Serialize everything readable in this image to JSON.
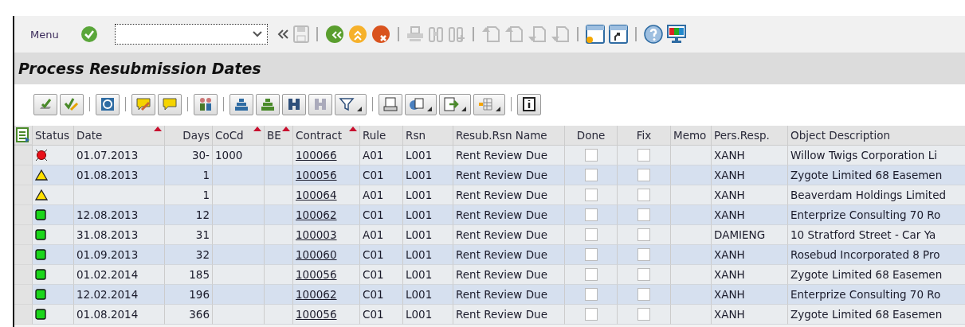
{
  "toolbar": {
    "menu": "Menu"
  },
  "title": "Process Resubmission Dates",
  "table": {
    "columns": [
      {
        "label": "Status",
        "sorted": false
      },
      {
        "label": "Date",
        "sorted": true
      },
      {
        "label": "Days",
        "sorted": false
      },
      {
        "label": "CoCd",
        "sorted": true
      },
      {
        "label": "BE",
        "sorted": true
      },
      {
        "label": "Contract",
        "sorted": true
      },
      {
        "label": "Rule",
        "sorted": false
      },
      {
        "label": "Rsn",
        "sorted": false
      },
      {
        "label": "Resub.Rsn Name",
        "sorted": false
      },
      {
        "label": "Done",
        "sorted": false
      },
      {
        "label": "Fix",
        "sorted": false
      },
      {
        "label": "Memo",
        "sorted": false
      },
      {
        "label": "Pers.Resp.",
        "sorted": false
      },
      {
        "label": "Object Description",
        "sorted": false
      }
    ],
    "rows": [
      {
        "kind": "error",
        "date": "01.07.2013",
        "days": "30-",
        "cocd": "1000",
        "contract": "100066",
        "rule": "A01",
        "rsn": "L001",
        "name": "Rent Review Due",
        "done": false,
        "fix": false,
        "person": "XANH",
        "description": "Willow Twigs Corporation Li"
      },
      {
        "kind": "warning",
        "date": "01.08.2013",
        "days": "1",
        "contract": "100056",
        "rule": "C01",
        "rsn": "L001",
        "name": "Rent Review Due",
        "done": false,
        "fix": false,
        "person": "XANH",
        "description": "Zygote Limited 68 Easemen"
      },
      {
        "kind": "warning",
        "days": "1",
        "contract": "100064",
        "rule": "A01",
        "rsn": "L001",
        "name": "Rent Review Due",
        "done": false,
        "fix": false,
        "person": "XANH",
        "description": "Beaverdam Holdings Limited"
      },
      {
        "kind": "ok",
        "date": "12.08.2013",
        "days": "12",
        "contract": "100062",
        "rule": "C01",
        "rsn": "L001",
        "name": "Rent Review Due",
        "done": false,
        "fix": false,
        "person": "XANH",
        "description": "Enterprize Consulting 70 Ro"
      },
      {
        "kind": "ok",
        "date": "31.08.2013",
        "days": "31",
        "contract": "100003",
        "rule": "A01",
        "rsn": "L001",
        "name": "Rent Review Due",
        "done": false,
        "fix": false,
        "person": "DAMIENG",
        "description": "10 Stratford Street - Car Ya"
      },
      {
        "kind": "ok",
        "date": "01.09.2013",
        "days": "32",
        "contract": "100060",
        "rule": "C01",
        "rsn": "L001",
        "name": "Rent Review Due",
        "done": false,
        "fix": false,
        "person": "XANH",
        "description": "Rosebud Incorporated 8 Pro"
      },
      {
        "kind": "ok",
        "date": "01.02.2014",
        "days": "185",
        "contract": "100056",
        "rule": "C01",
        "rsn": "L001",
        "name": "Rent Review Due",
        "done": false,
        "fix": false,
        "person": "XANH",
        "description": "Zygote Limited 68 Easemen"
      },
      {
        "kind": "ok",
        "date": "12.02.2014",
        "days": "196",
        "contract": "100062",
        "rule": "C01",
        "rsn": "L001",
        "name": "Rent Review Due",
        "done": false,
        "fix": false,
        "person": "XANH",
        "description": "Enterprize Consulting 70 Ro"
      },
      {
        "kind": "ok",
        "date": "01.08.2014",
        "days": "366",
        "contract": "100056",
        "rule": "C01",
        "rsn": "L001",
        "name": "Rent Review Due",
        "done": false,
        "fix": false,
        "person": "XANH",
        "description": "Zygote Limited 68 Easemen"
      }
    ]
  }
}
